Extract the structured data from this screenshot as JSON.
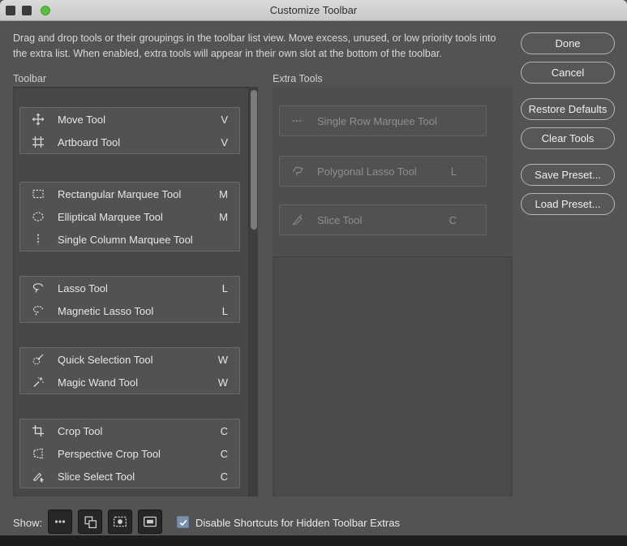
{
  "window": {
    "title": "Customize Toolbar"
  },
  "description": "Drag and drop tools or their groupings in the toolbar list view. Move excess, unused, or low priority tools into the extra list. When enabled, extra tools will appear in their own slot at the bottom of the toolbar.",
  "toolbar_panel": {
    "label": "Toolbar",
    "groups": [
      {
        "items": [
          {
            "name": "Move Tool",
            "shortcut": "V",
            "icon": "move-tool-icon"
          },
          {
            "name": "Artboard Tool",
            "shortcut": "V",
            "icon": "artboard-tool-icon"
          }
        ]
      },
      {
        "items": [
          {
            "name": "Rectangular Marquee Tool",
            "shortcut": "M",
            "icon": "rectangular-marquee-icon"
          },
          {
            "name": "Elliptical Marquee Tool",
            "shortcut": "M",
            "icon": "elliptical-marquee-icon"
          },
          {
            "name": "Single Column Marquee Tool",
            "shortcut": "",
            "icon": "single-column-marquee-icon"
          }
        ]
      },
      {
        "items": [
          {
            "name": "Lasso Tool",
            "shortcut": "L",
            "icon": "lasso-icon"
          },
          {
            "name": "Magnetic Lasso Tool",
            "shortcut": "L",
            "icon": "magnetic-lasso-icon"
          }
        ]
      },
      {
        "items": [
          {
            "name": "Quick Selection Tool",
            "shortcut": "W",
            "icon": "quick-selection-icon"
          },
          {
            "name": "Magic Wand Tool",
            "shortcut": "W",
            "icon": "magic-wand-icon"
          }
        ]
      },
      {
        "items": [
          {
            "name": "Crop Tool",
            "shortcut": "C",
            "icon": "crop-tool-icon"
          },
          {
            "name": "Perspective Crop Tool",
            "shortcut": "C",
            "icon": "perspective-crop-icon"
          },
          {
            "name": "Slice Select Tool",
            "shortcut": "C",
            "icon": "slice-select-icon"
          }
        ]
      }
    ]
  },
  "extra_panel": {
    "label": "Extra Tools",
    "items": [
      {
        "name": "Single Row Marquee Tool",
        "shortcut": "",
        "icon": "single-row-marquee-icon"
      },
      {
        "name": "Polygonal Lasso Tool",
        "shortcut": "L",
        "icon": "polygonal-lasso-icon"
      },
      {
        "name": "Slice Tool",
        "shortcut": "C",
        "icon": "slice-tool-icon"
      }
    ]
  },
  "buttons": {
    "done": "Done",
    "cancel": "Cancel",
    "restore_defaults": "Restore Defaults",
    "clear_tools": "Clear Tools",
    "save_preset": "Save Preset...",
    "load_preset": "Load Preset..."
  },
  "footer": {
    "show_label": "Show:",
    "checkbox_label": "Disable Shortcuts for Hidden Toolbar Extras",
    "checkbox_checked": true,
    "show_buttons": [
      "extra-tools-ellipsis",
      "color-swatches",
      "quick-mask-mode",
      "screen-mode"
    ]
  },
  "colors": {
    "dialog_background": "#535353",
    "checkbox_accent": "#7792aa",
    "titlebar_zoom_green": "#62ba46"
  }
}
